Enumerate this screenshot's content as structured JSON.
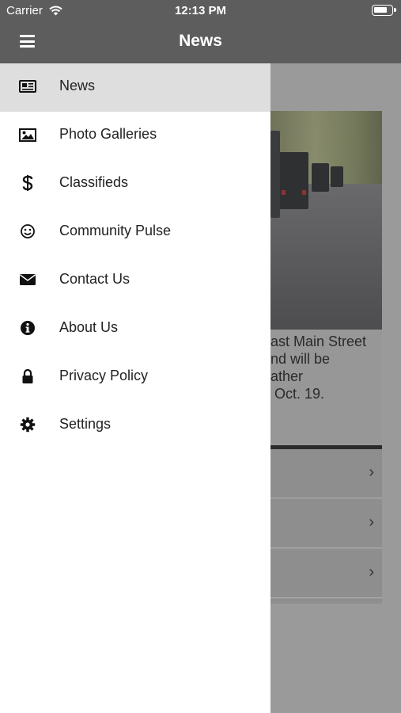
{
  "status_bar": {
    "carrier": "Carrier",
    "time": "12:13 PM"
  },
  "header": {
    "title": "News"
  },
  "menu": {
    "items": [
      {
        "label": "News",
        "icon": "newspaper-icon",
        "active": true
      },
      {
        "label": "Photo Galleries",
        "icon": "image-icon"
      },
      {
        "label": "Classifieds",
        "icon": "dollar-icon"
      },
      {
        "label": "Community Pulse",
        "icon": "smiley-icon"
      },
      {
        "label": "Contact Us",
        "icon": "envelope-icon"
      },
      {
        "label": "About Us",
        "icon": "info-icon"
      },
      {
        "label": "Privacy Policy",
        "icon": "lock-icon"
      },
      {
        "label": "Settings",
        "icon": "gear-icon"
      }
    ]
  },
  "background": {
    "article_excerpt": "ast Main Street\nnd will be\nather\n Oct. 19.",
    "list_chevron": "›"
  },
  "colors": {
    "nav_bar": "#5d5d5d",
    "active_item": "#dedede",
    "drawer": "#ffffff"
  }
}
